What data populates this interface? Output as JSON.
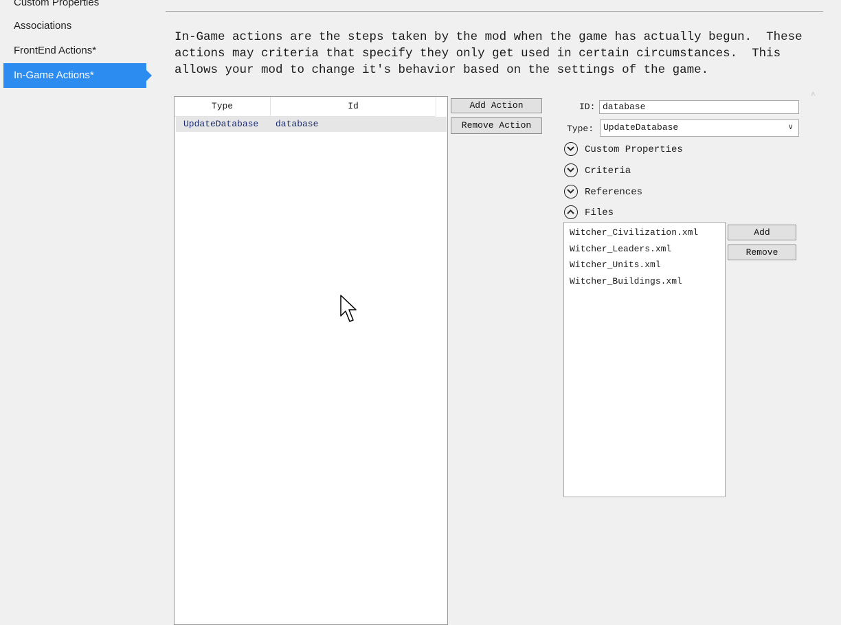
{
  "sidebar": {
    "items": [
      {
        "label": "Custom Properties",
        "active": false
      },
      {
        "label": "Associations",
        "active": false
      },
      {
        "label": "FrontEnd Actions*",
        "active": false
      },
      {
        "label": "In-Game Actions*",
        "active": true
      }
    ],
    "accent": "#2d8cf0"
  },
  "description": "In-Game actions are the steps taken by the mod when the game has actually begun.  These\nactions may criteria that specify they only get used in certain circumstances.  This\nallows your mod to change it's behavior based on the settings of the game.",
  "actions_list": {
    "columns": [
      "Type",
      "Id"
    ],
    "rows": [
      {
        "type": "UpdateDatabase",
        "id": "database"
      }
    ]
  },
  "buttons": {
    "add_action": "Add Action",
    "remove_action": "Remove Action"
  },
  "details": {
    "id_label": "ID:",
    "id_value": "database",
    "type_label": "Type:",
    "type_value": "UpdateDatabase",
    "sections": [
      {
        "label": "Custom Properties",
        "expanded": false
      },
      {
        "label": "Criteria",
        "expanded": false
      },
      {
        "label": "References",
        "expanded": false
      },
      {
        "label": "Files",
        "expanded": true
      }
    ],
    "files": [
      "Witcher_Civilization.xml",
      "Witcher_Leaders.xml",
      "Witcher_Units.xml",
      "Witcher_Buildings.xml"
    ],
    "add_label": "Add",
    "remove_label": "Remove"
  }
}
